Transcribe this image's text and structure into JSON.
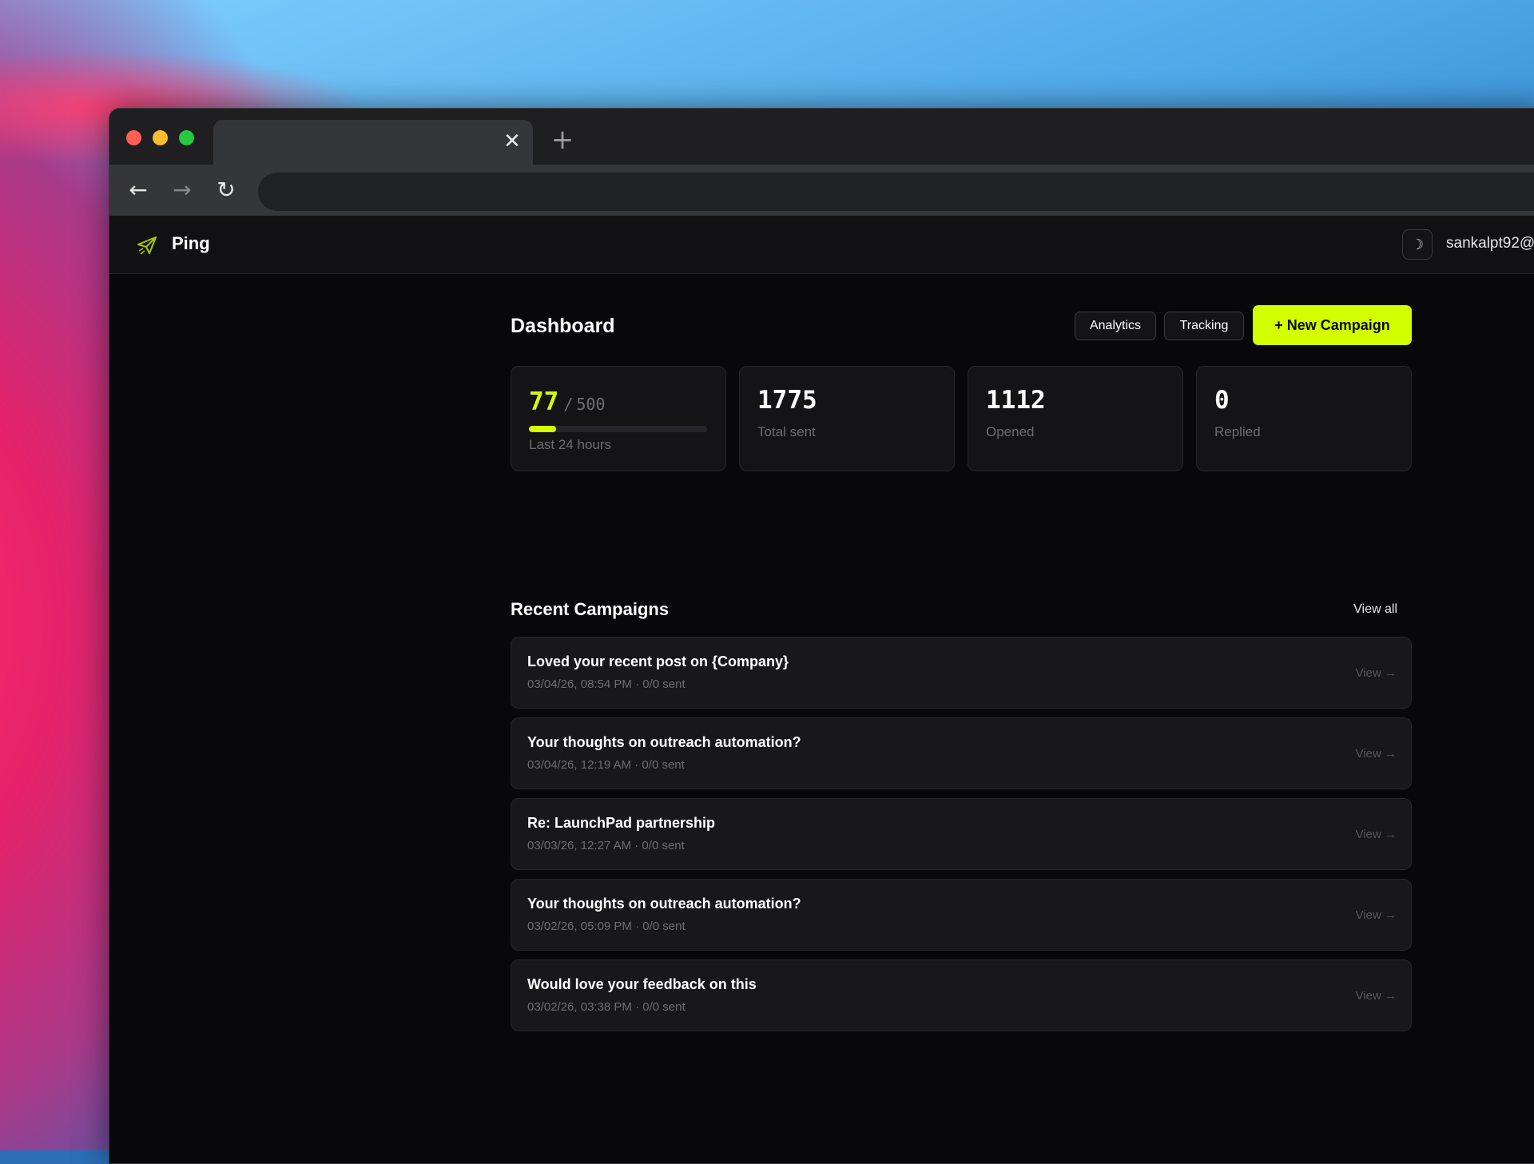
{
  "browser": {
    "tab_close": "✕",
    "new_tab": "+",
    "back": "←",
    "forward": "→",
    "reload": "↻"
  },
  "app": {
    "brand": "Ping",
    "logo_icon": "paper-plane-icon",
    "theme_toggle": "☽",
    "user_email": "sankalpt92@"
  },
  "colors": {
    "accent": "#d4ff00",
    "background": "#08080a",
    "card": "#141417"
  },
  "dashboard": {
    "title": "Dashboard",
    "analytics_label": "Analytics",
    "tracking_label": "Tracking",
    "new_campaign_label": "+ New Campaign"
  },
  "stats": {
    "quota": {
      "used": "77",
      "separator": "/",
      "total": "500",
      "fraction": 0.154,
      "label": "Last 24 hours"
    },
    "total_sent": {
      "value": "1775",
      "label": "Total sent"
    },
    "opened": {
      "value": "1112",
      "label": "Opened"
    },
    "replied": {
      "value": "0",
      "label": "Replied"
    }
  },
  "recent": {
    "title": "Recent Campaigns",
    "view_all": "View all",
    "items": [
      {
        "title": "Loved your recent post on {Company}",
        "meta": "03/04/26, 08:54 PM · 0/0 sent",
        "action": "View →"
      },
      {
        "title": "Your thoughts on outreach automation?",
        "meta": "03/04/26, 12:19 AM · 0/0 sent",
        "action": "View →"
      },
      {
        "title": "Re: LaunchPad partnership",
        "meta": "03/03/26, 12:27 AM · 0/0 sent",
        "action": "View →"
      },
      {
        "title": "Your thoughts on outreach automation?",
        "meta": "03/02/26, 05:09 PM · 0/0 sent",
        "action": "View →"
      },
      {
        "title": "Would love your feedback on this",
        "meta": "03/02/26, 03:38 PM · 0/0 sent",
        "action": "View →"
      }
    ]
  }
}
